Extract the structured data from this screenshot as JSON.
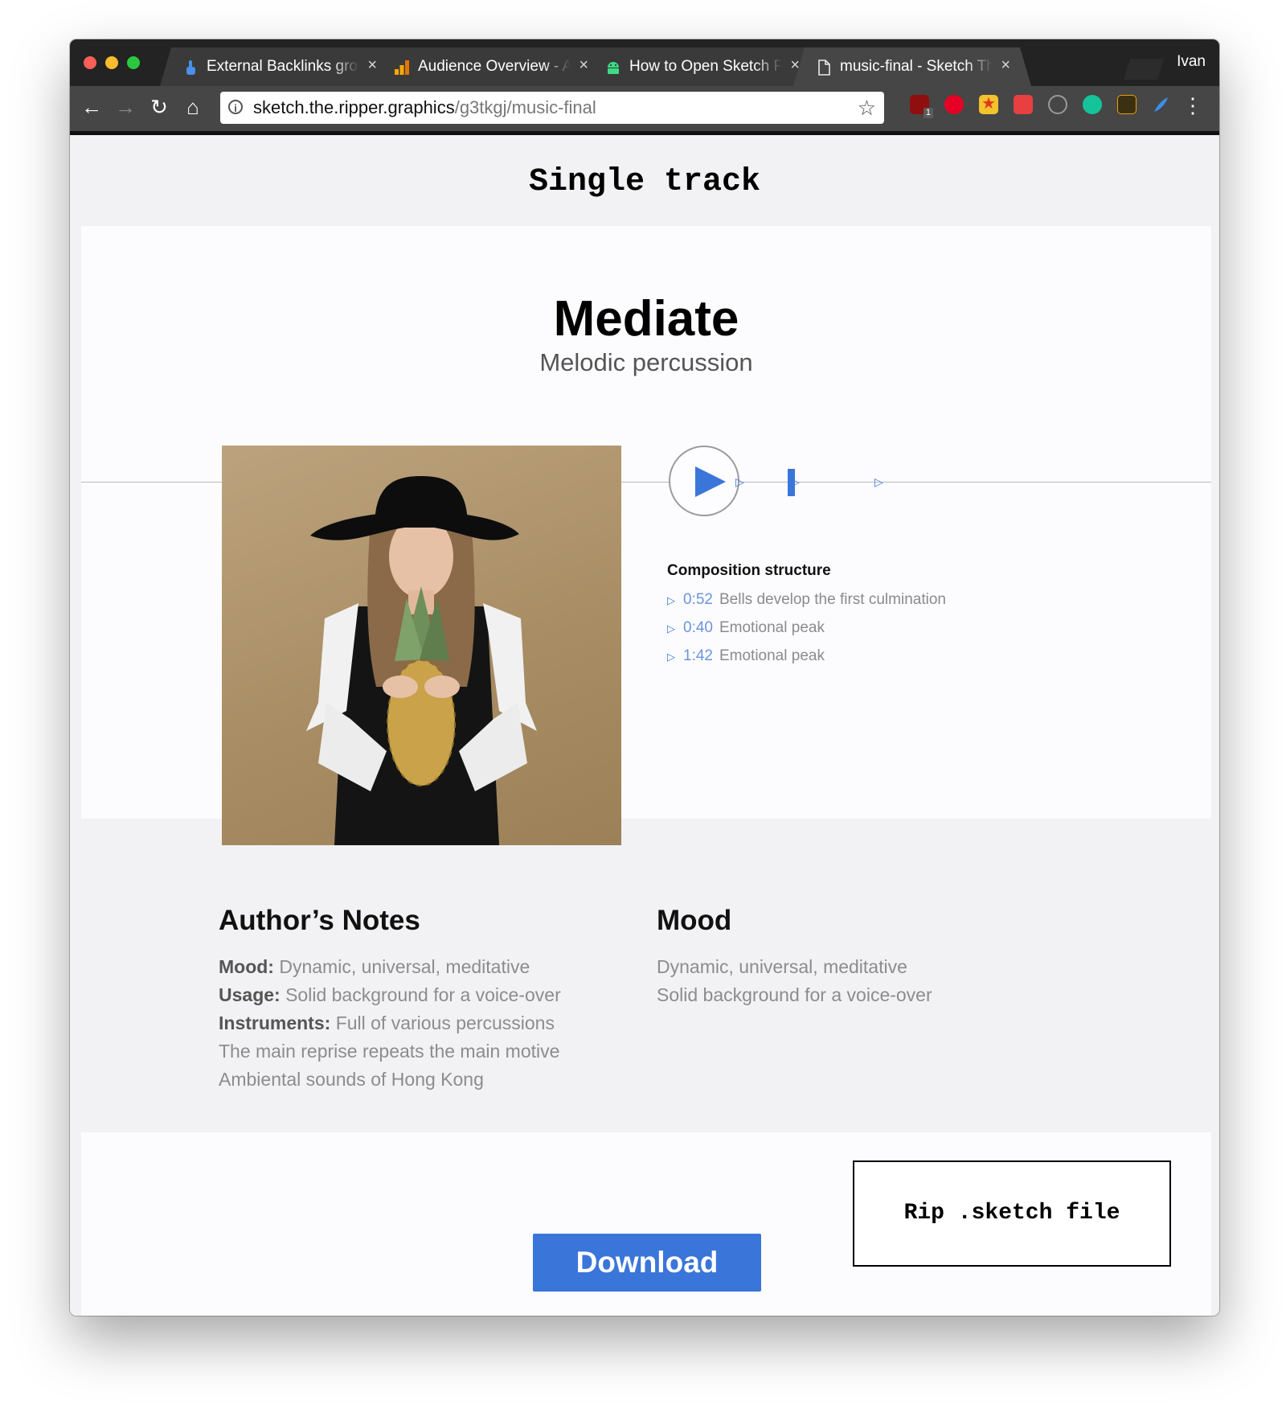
{
  "browser": {
    "tabs": [
      {
        "title": "External Backlinks group",
        "icon": "hand-pointer-icon",
        "active": false
      },
      {
        "title": "Audience Overview - Analytics",
        "icon": "analytics-bar-icon",
        "active": false
      },
      {
        "title": "How to Open Sketch Files",
        "icon": "android-icon",
        "active": false
      },
      {
        "title": "music-final - Sketch The Ripper",
        "icon": "document-icon",
        "active": true
      }
    ],
    "close_glyph": "×",
    "profile_name": "Ivan",
    "url_host": "sketch.the.ripper.graphics",
    "url_path": "/g3tkgj/music-final",
    "info_glyph": "i",
    "extensions_badge": "1",
    "extensions": [
      "ublock-icon",
      "pinterest-icon",
      "bookmark-star-icon",
      "red-box-icon",
      "info-circle-icon",
      "grammarly-icon",
      "k-icon",
      "feather-icon"
    ],
    "colors": {
      "accent": "#3a75d9"
    }
  },
  "page": {
    "heading": "Single track",
    "track": {
      "title": "Mediate",
      "subtitle": "Melodic percussion"
    },
    "composition": {
      "title": "Composition structure",
      "items": [
        {
          "time": "0:52",
          "text": "Bells develop the first culmination"
        },
        {
          "time": "0:40",
          "text": "Emotional peak"
        },
        {
          "time": "1:42",
          "text": "Emotional peak"
        }
      ]
    },
    "authors_notes": {
      "title": "Author’s Notes",
      "lines": [
        {
          "label": "Mood:",
          "text": "Dynamic, universal, meditative"
        },
        {
          "label": "Usage:",
          "text": "Solid background for a voice-over"
        },
        {
          "label": "Instruments:",
          "text": "Full of various percussions"
        },
        {
          "label": "",
          "text": "The main reprise repeats the main motive"
        },
        {
          "label": "",
          "text": "Ambiental sounds of Hong Kong"
        }
      ]
    },
    "mood": {
      "title": "Mood",
      "lines": [
        "Dynamic, universal, meditative",
        "Solid background for a voice-over"
      ]
    },
    "buttons": {
      "rip": "Rip .sketch file",
      "download": "Download"
    }
  }
}
